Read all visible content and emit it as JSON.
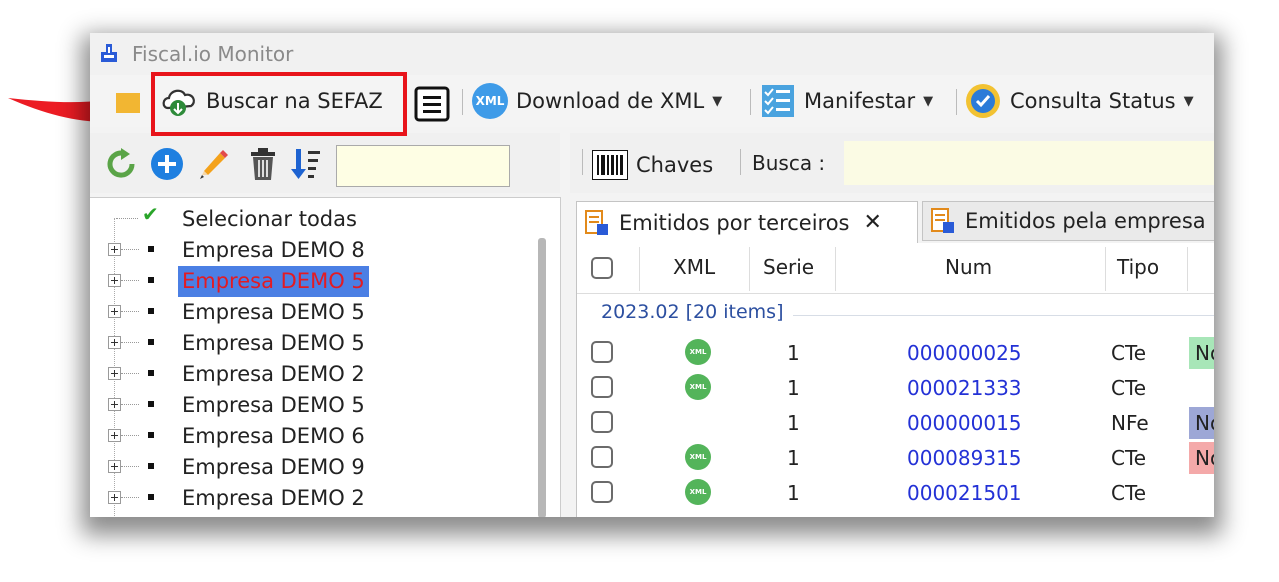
{
  "window": {
    "title": "Fiscal.io Monitor"
  },
  "toolbar": {
    "buscar_label": "Buscar na SEFAZ",
    "download_label": "Download de XML",
    "manifestar_label": "Manifestar",
    "consulta_label": "Consulta Status",
    "xml_badge": "XML"
  },
  "left_panel": {
    "filter_value": "",
    "tree": {
      "select_all": "Selecionar todas",
      "items": [
        {
          "label": "Empresa DEMO 8",
          "selected": false
        },
        {
          "label": "Empresa DEMO 5",
          "selected": true
        },
        {
          "label": "Empresa DEMO 5",
          "selected": false
        },
        {
          "label": "Empresa DEMO 5",
          "selected": false
        },
        {
          "label": "Empresa DEMO 2",
          "selected": false
        },
        {
          "label": "Empresa DEMO 5",
          "selected": false
        },
        {
          "label": "Empresa DEMO 6",
          "selected": false
        },
        {
          "label": "Empresa DEMO 9",
          "selected": false
        },
        {
          "label": "Empresa DEMO 2",
          "selected": false
        }
      ]
    }
  },
  "right_panel": {
    "chaves_label": "Chaves",
    "busca_label": "Busca :",
    "busca_value": "",
    "tabs": [
      {
        "label": "Emitidos por terceiros",
        "active": true
      },
      {
        "label": "Emitidos pela empresa",
        "active": false
      }
    ],
    "grid": {
      "columns": [
        "XML",
        "Serie",
        "Num",
        "Tipo"
      ],
      "group_label": "2023.02 [20 items]",
      "xml_badge": "XML",
      "rows": [
        {
          "has_xml": true,
          "serie": "1",
          "num": "000000025",
          "tipo": "CTe",
          "tag": "No",
          "tag_color": "#a8e6b8"
        },
        {
          "has_xml": true,
          "serie": "1",
          "num": "000021333",
          "tipo": "CTe",
          "tag": "",
          "tag_color": ""
        },
        {
          "has_xml": false,
          "serie": "1",
          "num": "000000015",
          "tipo": "NFe",
          "tag": "No",
          "tag_color": "#9da7d6"
        },
        {
          "has_xml": true,
          "serie": "1",
          "num": "000089315",
          "tipo": "CTe",
          "tag": "No",
          "tag_color": "#f4a9a9"
        },
        {
          "has_xml": true,
          "serie": "1",
          "num": "000021501",
          "tipo": "CTe",
          "tag": "",
          "tag_color": ""
        }
      ]
    }
  },
  "colors": {
    "highlight": "#e8141b",
    "selection": "#4b7fe4",
    "link": "#2331d6"
  }
}
